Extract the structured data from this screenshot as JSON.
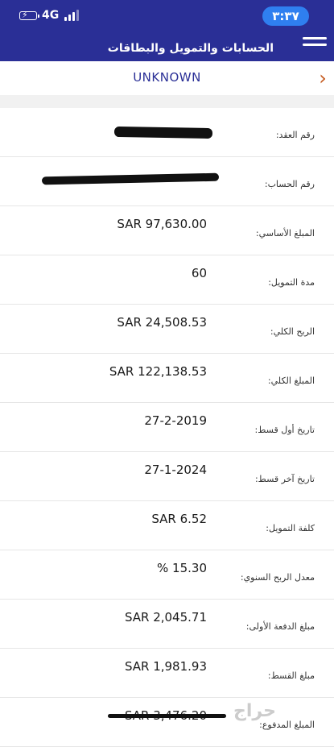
{
  "status_bar": {
    "network": "4G",
    "time": "٣:٣٧"
  },
  "header": {
    "title": "الحسابات والتمويل والبطاقات",
    "subheader_name": "UNKNOWN"
  },
  "details": [
    {
      "label": "رقم العقد:",
      "value": ""
    },
    {
      "label": "رقم الحساب:",
      "value": ""
    },
    {
      "label": "المبلغ الأساسي:",
      "value": "SAR 97,630.00"
    },
    {
      "label": "مدة التمويل:",
      "value": "60"
    },
    {
      "label": "الربح الكلي:",
      "value": "SAR 24,508.53"
    },
    {
      "label": "المبلغ الكلي:",
      "value": "SAR 122,138.53"
    },
    {
      "label": "تاريخ أول قسط:",
      "value": "27-2-2019"
    },
    {
      "label": "تاريخ آخر قسط:",
      "value": "27-1-2024"
    },
    {
      "label": "كلفة التمويل:",
      "value": "SAR 6.52"
    },
    {
      "label": "معدل الربح السنوي:",
      "value": "% 15.30"
    },
    {
      "label": "مبلغ الدفعة الأولى:",
      "value": "SAR 2,045.71"
    },
    {
      "label": "مبلغ القسط:",
      "value": "SAR 1,981.93"
    },
    {
      "label": "المبلغ المدفوع:",
      "value": "SAR 3,476.20"
    }
  ],
  "watermark": "حراج",
  "colors": {
    "header_bg": "#2a2f96",
    "time_pill": "#2f7ff0",
    "back_arrow": "#c55a1e",
    "subheader_text": "#2a2f96"
  },
  "icons": {
    "battery": "battery-charging-icon",
    "signal": "signal-bars-icon",
    "menu": "hamburger-menu-icon",
    "back": "chevron-right-icon"
  }
}
